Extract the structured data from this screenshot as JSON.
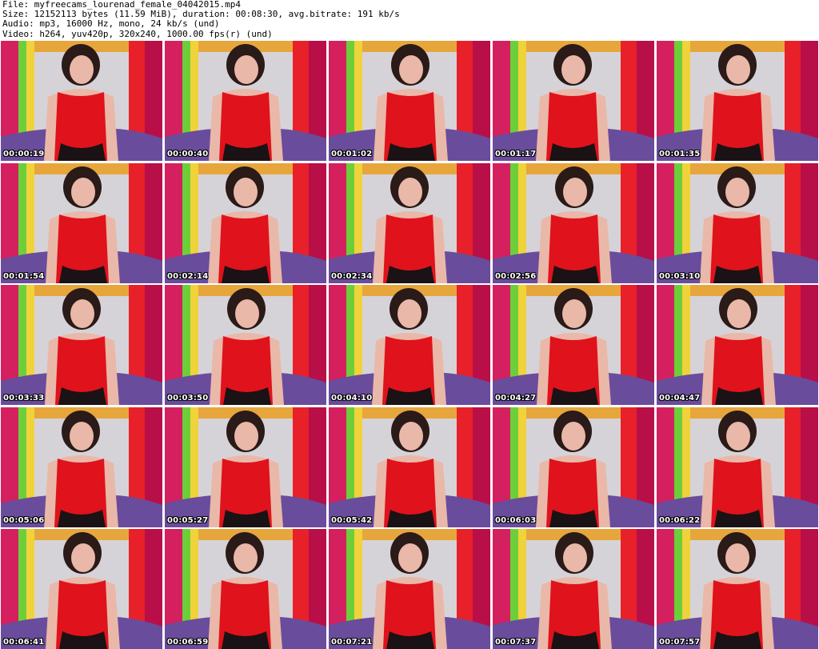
{
  "header": {
    "file_line": "File: myfreecams_lourenad_female_04042015.mp4",
    "size_line": "Size: 12152113 bytes (11.59 MiB), duration: 00:08:30, avg.bitrate: 191 kb/s",
    "audio_line": "Audio: mp3, 16000 Hz, mono, 24 kb/s (und)",
    "video_line": "Video: h264, yuv420p, 320x240, 1000.00 fps(r) (und)"
  },
  "thumbnails": [
    {
      "timestamp": "00:00:19"
    },
    {
      "timestamp": "00:00:40"
    },
    {
      "timestamp": "00:01:02"
    },
    {
      "timestamp": "00:01:17"
    },
    {
      "timestamp": "00:01:35"
    },
    {
      "timestamp": "00:01:54"
    },
    {
      "timestamp": "00:02:14"
    },
    {
      "timestamp": "00:02:34"
    },
    {
      "timestamp": "00:02:56"
    },
    {
      "timestamp": "00:03:10"
    },
    {
      "timestamp": "00:03:33"
    },
    {
      "timestamp": "00:03:50"
    },
    {
      "timestamp": "00:04:10"
    },
    {
      "timestamp": "00:04:27"
    },
    {
      "timestamp": "00:04:47"
    },
    {
      "timestamp": "00:05:06"
    },
    {
      "timestamp": "00:05:27"
    },
    {
      "timestamp": "00:05:42"
    },
    {
      "timestamp": "00:06:03"
    },
    {
      "timestamp": "00:06:22"
    },
    {
      "timestamp": "00:06:41"
    },
    {
      "timestamp": "00:06:59"
    },
    {
      "timestamp": "00:07:21"
    },
    {
      "timestamp": "00:07:37"
    },
    {
      "timestamp": "00:07:57"
    }
  ],
  "colors": {
    "curtain_magenta": "#c8185a",
    "curtain_red": "#e8202a",
    "wall_gray": "#d6d3d8",
    "dress_red": "#e0121c",
    "blanket_purple": "#6a4c9c",
    "hair_dark": "#2a1a18",
    "skin": "#e9b8a8",
    "green_stripe": "#6ccf3a"
  }
}
